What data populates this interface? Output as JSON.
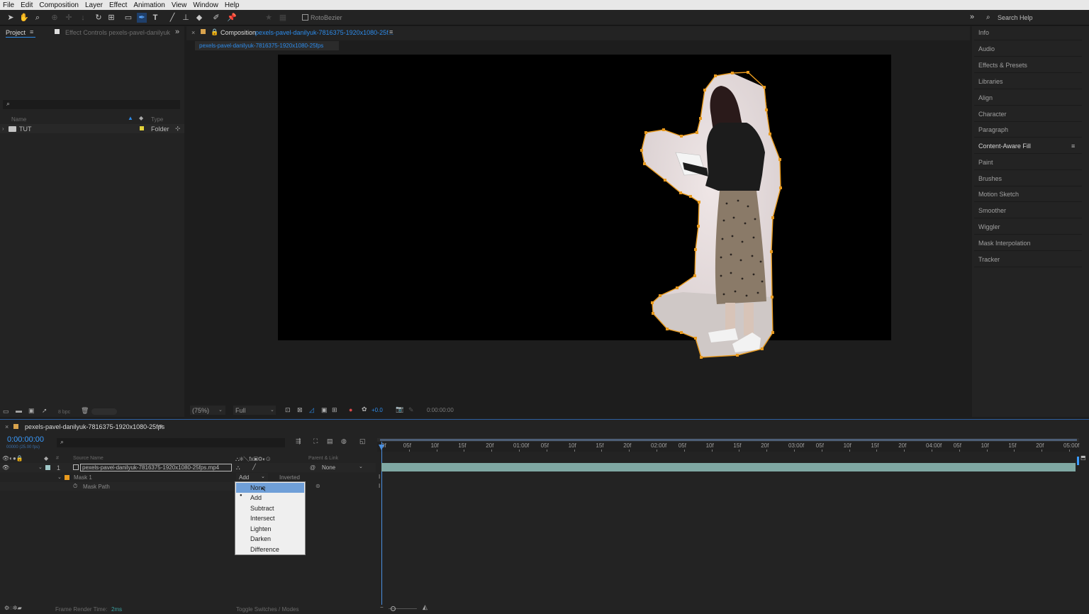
{
  "menu": [
    "File",
    "Edit",
    "Composition",
    "Layer",
    "Effect",
    "Animation",
    "View",
    "Window",
    "Help"
  ],
  "toolbar": {
    "roto_label": "RotoBezier",
    "search_help": "Search Help"
  },
  "project_panel": {
    "tab_project": "Project",
    "tab_effect_controls": "Effect Controls pexels-pavel-danilyuk",
    "col_name": "Name",
    "col_type": "Type",
    "row_name": "TUT",
    "row_type": "Folder",
    "bpc": "8 bpc"
  },
  "composition_panel": {
    "tab_prefix": "Composition",
    "tab_name": "pexels-pavel-danilyuk-7816375-1920x1080-25f...",
    "breadcrumb": "pexels-pavel-danilyuk-7816375-1920x1080-25fps",
    "zoom": "(75%)",
    "resolution": "Full",
    "exposure": "+0.0",
    "timecode": "0:00:00:00"
  },
  "right_panel": {
    "items": [
      "Info",
      "Audio",
      "Effects & Presets",
      "Libraries",
      "Align",
      "Character",
      "Paragraph",
      "Content-Aware Fill",
      "Paint",
      "Brushes",
      "Motion Sketch",
      "Smoother",
      "Wiggler",
      "Mask Interpolation",
      "Tracker"
    ]
  },
  "timeline": {
    "tab_name": "pexels-pavel-danilyuk-7816375-1920x1080-25fps",
    "timecode": "0:00:00:00",
    "timecode_sub": "00000 (25.00 fps)",
    "col_source_name": "Source Name",
    "col_parent": "Parent & Link",
    "layer_number": "1",
    "layer_name": "pexels-pavel-danilyuk-7816375-1920x1080-25fps.mp4",
    "parent_value": "None",
    "mask_name": "Mask 1",
    "mask_mode": "Add",
    "inverted_label": "Inverted",
    "mask_path": "Mask Path",
    "ruler": [
      "0f",
      "05f",
      "10f",
      "15f",
      "20f",
      "01:00f",
      "05f",
      "10f",
      "15f",
      "20f",
      "02:00f",
      "05f",
      "10f",
      "15f",
      "20f",
      "03:00f",
      "05f",
      "10f",
      "15f",
      "20f",
      "04:00f",
      "05f",
      "10f",
      "15f",
      "20f",
      "05:00f"
    ],
    "frame_render_label": "Frame Render Time:",
    "frame_render_value": "2ms",
    "toggle_label": "Toggle Switches / Modes"
  },
  "mask_mode_dropdown": {
    "options": [
      "None",
      "Add",
      "Subtract",
      "Intersect",
      "Lighten",
      "Darken",
      "Difference"
    ],
    "selected": "Add",
    "highlighted": "None"
  },
  "colors": {
    "accent_blue": "#2d8ceb",
    "mask_orange": "#e89a1e",
    "clip_bar": "#7fa8a3",
    "highlight": "#6f9fd8"
  }
}
